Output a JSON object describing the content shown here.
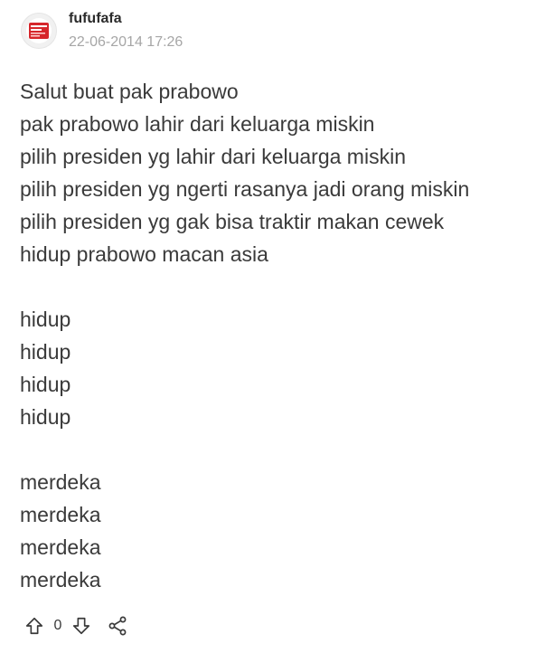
{
  "post": {
    "username": "fufufafa",
    "timestamp": "22-06-2014 17:26",
    "avatar_colors": {
      "primary": "#d6262b",
      "secondary": "#ffffff"
    },
    "lines": [
      "Salut buat pak prabowo",
      "pak prabowo lahir dari keluarga miskin",
      "pilih presiden yg lahir dari keluarga miskin",
      "pilih presiden yg ngerti rasanya jadi orang miskin",
      "pilih presiden yg gak bisa traktir makan cewek",
      "hidup prabowo macan asia",
      "",
      "hidup",
      "hidup",
      "hidup",
      "hidup",
      "",
      "merdeka",
      "merdeka",
      "merdeka",
      "merdeka"
    ],
    "vote_count": "0"
  },
  "icons": {
    "upvote": "arrow-up-outline-icon",
    "downvote": "arrow-down-outline-icon",
    "share": "share-icon"
  },
  "colors": {
    "text": "#3a3a3a",
    "muted": "#a6a6a6",
    "username": "#2b2b2b"
  }
}
